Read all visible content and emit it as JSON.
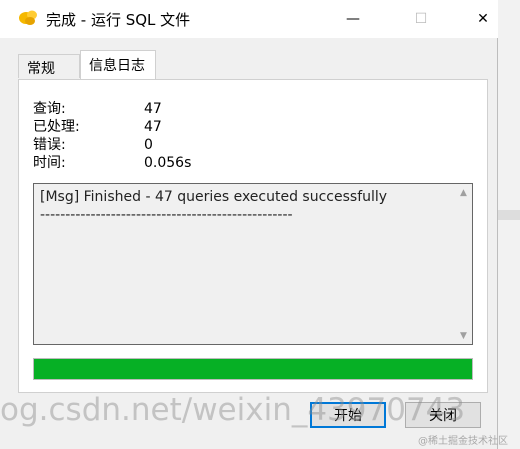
{
  "window": {
    "title": "完成 - 运行 SQL 文件",
    "minimize_glyph": "—",
    "maximize_glyph": "☐",
    "close_glyph": "✕"
  },
  "tabs": [
    {
      "label": "常规"
    },
    {
      "label": "信息日志"
    }
  ],
  "stats": [
    {
      "label": "查询:",
      "value": "47"
    },
    {
      "label": "已处理:",
      "value": "47"
    },
    {
      "label": "错误:",
      "value": "0"
    },
    {
      "label": "时间:",
      "value": "0.056s"
    }
  ],
  "log": {
    "text": "[Msg] Finished - 47 queries executed successfully\n--------------------------------------------------"
  },
  "progress": {
    "fraction": 1.0,
    "color": "#06b025"
  },
  "buttons": {
    "start": "开始",
    "close": "关闭"
  },
  "watermark": {
    "main": "og.csdn.net/weixin_43970743",
    "corner": "@稀土掘金技术社区"
  },
  "icons": {
    "app": "navicat-icon",
    "scroll_up": "▲",
    "scroll_down": "▼"
  }
}
